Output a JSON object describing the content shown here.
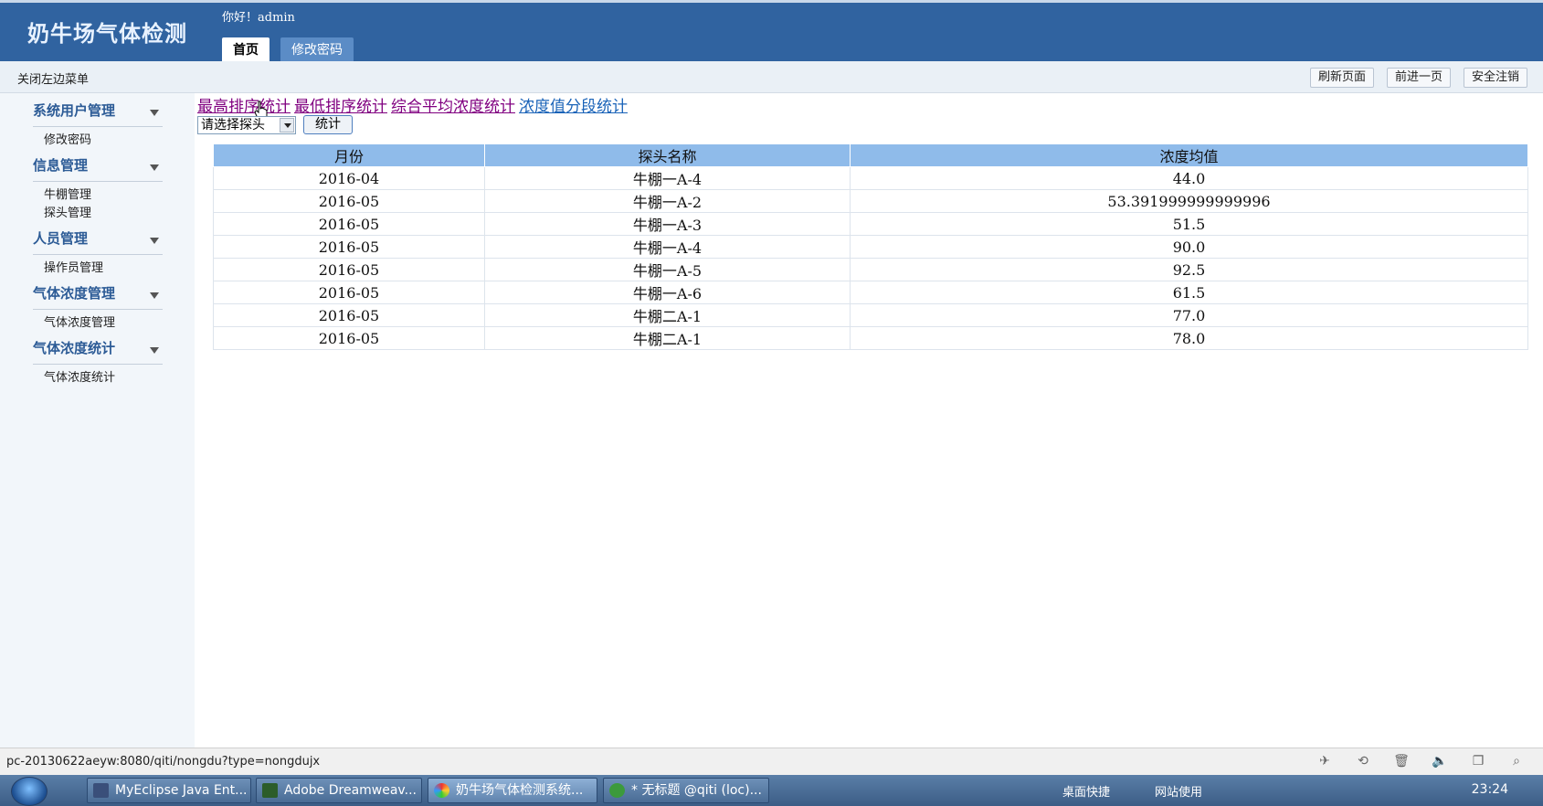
{
  "header": {
    "app_title": "奶牛场气体检测",
    "greeting": "你好！admin",
    "tabs": [
      {
        "label": "首页"
      },
      {
        "label": "修改密码"
      }
    ]
  },
  "toolbar": {
    "close_menu": "关闭左边菜单",
    "refresh": "刷新页面",
    "forward": "前进一页",
    "logout": "安全注销"
  },
  "sidebar": {
    "groups": [
      {
        "title": "系统用户管理",
        "items": [
          "修改密码"
        ]
      },
      {
        "title": "信息管理",
        "items": [
          "牛棚管理",
          "探头管理"
        ]
      },
      {
        "title": "人员管理",
        "items": [
          "操作员管理"
        ]
      },
      {
        "title": "气体浓度管理",
        "items": [
          "气体浓度管理"
        ]
      },
      {
        "title": "气体浓度统计",
        "items": [
          "气体浓度统计"
        ]
      }
    ]
  },
  "main": {
    "links": [
      {
        "label": "最高排序统计"
      },
      {
        "label": "最低排序统计"
      },
      {
        "label": "综合平均浓度统计"
      },
      {
        "label": "浓度值分段统计"
      }
    ],
    "probe_select": {
      "value": "请选择探头"
    },
    "stat_button": "统计",
    "table": {
      "headers": [
        "月份",
        "探头名称",
        "浓度均值"
      ],
      "rows": [
        [
          "2016-04",
          "牛棚一A-4",
          "44.0"
        ],
        [
          "2016-05",
          "牛棚一A-2",
          "53.391999999999996"
        ],
        [
          "2016-05",
          "牛棚一A-3",
          "51.5"
        ],
        [
          "2016-05",
          "牛棚一A-4",
          "90.0"
        ],
        [
          "2016-05",
          "牛棚一A-5",
          "92.5"
        ],
        [
          "2016-05",
          "牛棚一A-6",
          "61.5"
        ],
        [
          "2016-05",
          "牛棚二A-1",
          "77.0"
        ],
        [
          "2016-05",
          "牛棚二A-1",
          "78.0"
        ]
      ]
    }
  },
  "statusbar": {
    "url": "pc-20130622aeyw:8080/qiti/nongdu?type=nongdujx"
  },
  "taskbar": {
    "buttons": [
      {
        "label": "MyEclipse Java Ent..."
      },
      {
        "label": "Adobe Dreamweav..."
      },
      {
        "label": "奶牛场气体检测系统..."
      },
      {
        "label": "* 无标题 @qiti (loc)..."
      }
    ],
    "tray_desktop": "桌面快捷",
    "tray_sites": "网站使用",
    "clock": "23:24"
  },
  "colors": {
    "header_bg": "#3063a0",
    "table_header_bg": "#8fbbea",
    "sidebar_heading": "#2c5b96"
  }
}
